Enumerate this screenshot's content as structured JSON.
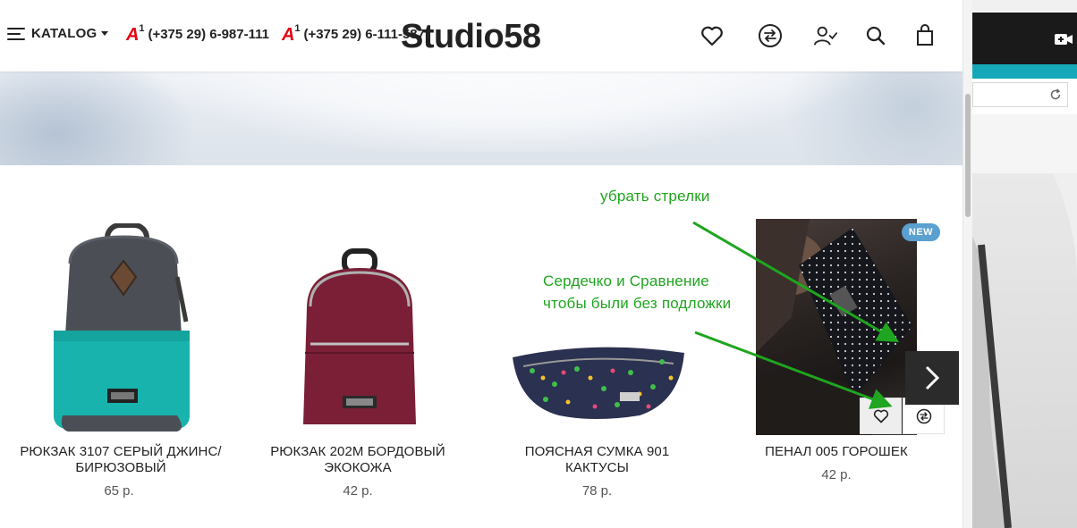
{
  "header": {
    "catalog_label": "KATALOG",
    "phones": [
      "(+375 29) 6-987-111",
      "(+375 29) 6-111-587"
    ],
    "operator_logo": "A",
    "operator_logo_sup": "1",
    "logo_text": "Studio58",
    "icons": [
      "heart-icon",
      "compare-icon",
      "user-icon",
      "search-icon",
      "cart-icon"
    ]
  },
  "products": [
    {
      "title": "РЮКЗАК 3107 СЕРЫЙ ДЖИНС/ БИРЮЗОВЫЙ",
      "price": "65 р."
    },
    {
      "title": "РЮКЗАК 202М БОРДОВЫЙ ЭКОКОЖА",
      "price": "42 р."
    },
    {
      "title": "ПОЯСНАЯ СУМКА 901 КАКТУСЫ",
      "price": "78 р."
    },
    {
      "title": "ПЕНАЛ 005 ГОРОШЕК",
      "price": "42 р.",
      "badge": "NEW"
    }
  ],
  "annotations": {
    "note1": "убрать стрелки",
    "note2_line1": "Сердечко и Сравнение",
    "note2_line2": "чтобы были без подложки"
  },
  "colors": {
    "annotation_green": "#1fa51f",
    "badge_blue": "#5aa0d0",
    "arrow_bg": "#2b2b2b",
    "backpack_teal": "#19b3ad",
    "backpack_burgundy": "#7a1f36"
  }
}
